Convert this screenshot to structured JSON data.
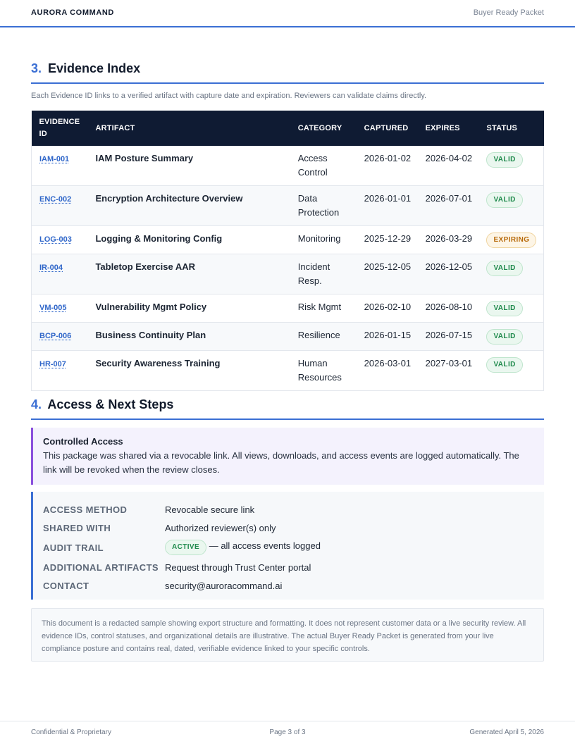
{
  "header": {
    "brand": "AURORA COMMAND",
    "packet": "Buyer Ready Packet"
  },
  "evidence": {
    "number": "3.",
    "title": "Evidence Index",
    "intro": "Each Evidence ID links to a verified artifact with capture date and expiration. Reviewers can validate claims directly.",
    "columns": {
      "id": "EVIDENCE ID",
      "artifact": "ARTIFACT",
      "category": "CATEGORY",
      "captured": "CAPTURED",
      "expires": "EXPIRES",
      "status": "STATUS"
    },
    "rows": [
      {
        "id": "IAM-001",
        "artifact": "IAM Posture Summary",
        "category": "Access Control",
        "captured": "2026-01-02",
        "expires": "2026-04-02",
        "status": "VALID"
      },
      {
        "id": "ENC-002",
        "artifact": "Encryption Architecture Overview",
        "category": "Data Protection",
        "captured": "2026-01-01",
        "expires": "2026-07-01",
        "status": "VALID"
      },
      {
        "id": "LOG-003",
        "artifact": "Logging & Monitoring Config",
        "category": "Monitoring",
        "captured": "2025-12-29",
        "expires": "2026-03-29",
        "status": "EXPIRING"
      },
      {
        "id": "IR-004",
        "artifact": "Tabletop Exercise AAR",
        "category": "Incident Resp.",
        "captured": "2025-12-05",
        "expires": "2026-12-05",
        "status": "VALID"
      },
      {
        "id": "VM-005",
        "artifact": "Vulnerability Mgmt Policy",
        "category": "Risk Mgmt",
        "captured": "2026-02-10",
        "expires": "2026-08-10",
        "status": "VALID"
      },
      {
        "id": "BCP-006",
        "artifact": "Business Continuity Plan",
        "category": "Resilience",
        "captured": "2026-01-15",
        "expires": "2026-07-15",
        "status": "VALID"
      },
      {
        "id": "HR-007",
        "artifact": "Security Awareness Training",
        "category": "Human Resources",
        "captured": "2026-03-01",
        "expires": "2027-03-01",
        "status": "VALID"
      }
    ]
  },
  "access": {
    "number": "4.",
    "title": "Access & Next Steps",
    "callout_title": "Controlled Access",
    "callout_body": "This package was shared via a revocable link. All views, downloads, and access events are logged automatically. The link will be revoked when the review closes.",
    "method_label": "ACCESS METHOD",
    "method_value": "Revocable secure link",
    "shared_label": "SHARED WITH",
    "shared_value": "Authorized reviewer(s) only",
    "audit_label": "AUDIT TRAIL",
    "audit_badge": "ACTIVE",
    "audit_value": "— all access events logged",
    "artifacts_label": "ADDITIONAL ARTIFACTS",
    "artifacts_value": "Request through Trust Center portal",
    "contact_label": "CONTACT",
    "contact_value": "security@auroracommand.ai"
  },
  "disclaimer": "This document is a redacted sample showing export structure and formatting. It does not represent customer data or a live security review. All evidence IDs, control statuses, and organizational details are illustrative. The actual Buyer Ready Packet is generated from your live compliance posture and contains real, dated, verifiable evidence linked to your specific controls.",
  "footer": {
    "left": "Confidential & Proprietary",
    "center": "Page 3 of 3",
    "right": "Generated April 5, 2026"
  },
  "colors": {
    "accent": "#3b6fd4",
    "header_bg": "#0f1b33",
    "valid": "#1f8a4c",
    "expiring": "#b86a0a",
    "callout_border": "#8a4fdc"
  }
}
